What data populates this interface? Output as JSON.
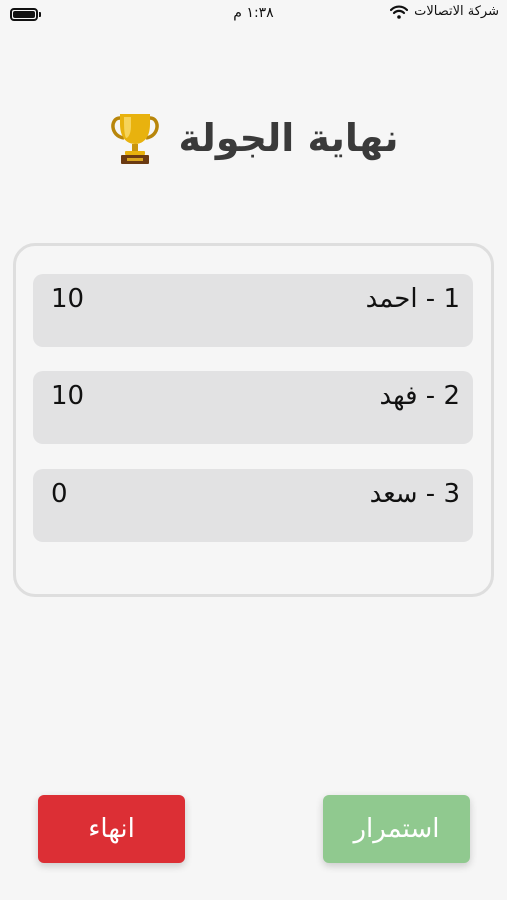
{
  "status_bar": {
    "carrier": "شركة الاتصالات",
    "time": "١:٣٨ م"
  },
  "title": "نهاية الجولة",
  "title_icon": "trophy-icon",
  "results": [
    {
      "name": "1 - احمد",
      "score": "10"
    },
    {
      "name": "2 - فهد",
      "score": "10"
    },
    {
      "name": "3 - سعد",
      "score": "0"
    }
  ],
  "buttons": {
    "end_label": "انهاء",
    "continue_label": "استمرار"
  },
  "colors": {
    "end_button": "#dc2f35",
    "continue_button": "#90c98f",
    "row_background": "#e2e2e3",
    "panel_border": "#dedede"
  }
}
